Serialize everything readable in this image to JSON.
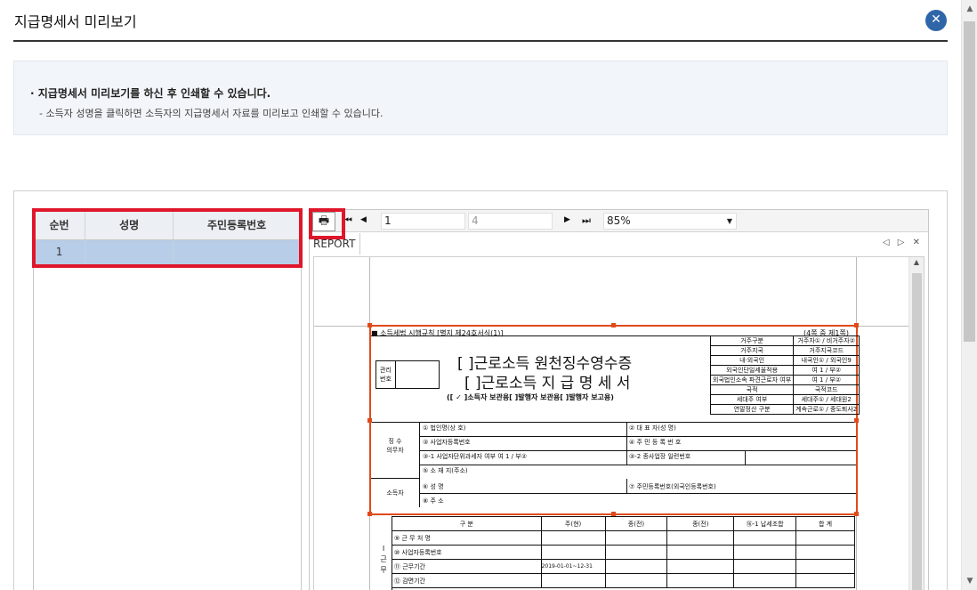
{
  "window": {
    "title": "지급명세서 미리보기",
    "close_glyph": "✕"
  },
  "info": {
    "line1": "· 지급명세서 미리보기를 하신 후 인쇄할 수 있습니다.",
    "line2": "- 소득자 성명을 클릭하면 소득자의 지급명세서 자료를 미리보고 인쇄할 수 있습니다."
  },
  "list": {
    "headers": [
      "순번",
      "성명",
      "주민등록번호"
    ],
    "rows": [
      {
        "seq": "1",
        "name": "",
        "rrn": ""
      }
    ]
  },
  "viewer": {
    "toolbar": {
      "print_icon": "printer-icon",
      "first_glyph": "⏮",
      "prev_glyph": "◀",
      "current_page": "1",
      "total_pages": "4",
      "next_glyph": "▶",
      "last_glyph": "⏭",
      "zoom": "85%"
    },
    "tab": "REPORT",
    "tab_controls": "◁ ▷ ✕"
  },
  "form": {
    "regulation": "■ 소득세법 시행규칙 [별지 제24호서식(1)]",
    "page_of": "(4쪽 중 제1쪽)",
    "title1": "[  ]근로소득 원천징수영수증",
    "title2": "[  ]근로소득 지 급 명 세 서",
    "copy_line": "([ ✓ ]소득자 보관용[      ]발행자 보관용[      ]발행자 보고용)",
    "mgmt_no": "관리\n번호",
    "right_table": [
      [
        "거주구분",
        "거주자① / 비거주자②"
      ],
      [
        "거주지국",
        "거주지국코드"
      ],
      [
        "내·외국인",
        "내국인① / 외국인9"
      ],
      [
        "외국인단일세율적용",
        "여 1 / 부②"
      ],
      [
        "외국법인소속 파견근로자 여부",
        "여 1 / 부②"
      ],
      [
        "국적",
        "국적코드"
      ],
      [
        "세대주 여부",
        "세대주① / 세대원2"
      ],
      [
        "연말정산 구분",
        "계속근로① / 중도퇴사2"
      ]
    ],
    "payer_label": "징 수\n의무자",
    "payer_rows": [
      [
        "① 법인명(상 호)",
        "② 대 표 자(성 명)"
      ],
      [
        "③ 사업자등록번호",
        "④ 주 민 등 록 번 호"
      ],
      [
        "③-1 사업자단위과세자 여부    여 1 / 부②",
        "③-2 종사업장 일련번호"
      ],
      [
        "⑤ 소 재 지(주소)",
        ""
      ]
    ],
    "earner_label": "소득자",
    "earner_rows": [
      [
        "⑥ 성         명",
        "⑦ 주민등록번호(외국인등록번호)"
      ],
      [
        "⑧ 주          소",
        ""
      ]
    ],
    "bottom_side": "Ⅰ 근 무",
    "bottom_headers": [
      "구 분",
      "주(현)",
      "종(전)",
      "종(전)",
      "⑯-1 납세조합",
      "합 계"
    ],
    "bottom_rows": [
      [
        "⑨ 근 무 처 명",
        "",
        "",
        "",
        "",
        ""
      ],
      [
        "⑩ 사업자등록번호",
        "",
        "",
        "",
        "",
        ""
      ],
      [
        "⑪ 근무기간",
        "2019-01-01~12-31",
        "",
        "",
        "",
        ""
      ],
      [
        "⑫ 감면기간",
        "",
        "",
        "",
        "",
        ""
      ]
    ]
  },
  "colors": {
    "accent": "#2f66a8",
    "highlight": "#e0162b",
    "selection": "#e04a1a",
    "selected_row": "#b8cde8"
  }
}
